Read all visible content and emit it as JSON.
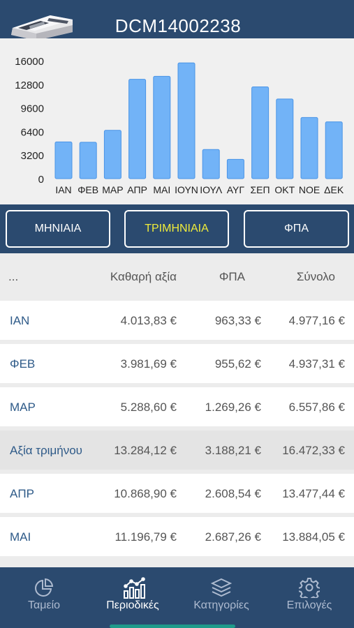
{
  "header": {
    "title": "DCM14002238",
    "device_icon": "cash-register-icon"
  },
  "chart_data": {
    "type": "bar",
    "categories": [
      "ΙΑΝ",
      "ΦΕΒ",
      "ΜΑΡ",
      "ΑΠΡ",
      "ΜΑΙ",
      "ΙΟΥΝ",
      "ΙΟΥΛ",
      "ΑΥΓ",
      "ΣΕΠ",
      "ΟΚΤ",
      "ΝΟΕ",
      "ΔΕΚ"
    ],
    "values": [
      4977,
      4937,
      6558,
      13477,
      13884,
      15700,
      3950,
      2620,
      12450,
      10800,
      8300,
      7700
    ],
    "yticks": [
      "0",
      "3200",
      "6400",
      "9600",
      "12800",
      "16000"
    ],
    "ylim": [
      0,
      16000
    ],
    "bar_color": "#72b3f7",
    "bar_border": "#4a94e6"
  },
  "segments": [
    {
      "label": "ΜΗΝΙΑΙΑ",
      "active": false
    },
    {
      "label": "ΤΡΙΜΗΝΙΑΙΑ",
      "active": true
    },
    {
      "label": "ΦΠΑ",
      "active": false
    }
  ],
  "table": {
    "headers": [
      "...",
      "Καθαρή αξία",
      "ΦΠΑ",
      "Σύνολο"
    ],
    "rows": [
      {
        "label": "ΙΑΝ",
        "net": "4.013,83 €",
        "vat": "963,33 €",
        "total": "4.977,16 €",
        "summary": false
      },
      {
        "label": "ΦΕΒ",
        "net": "3.981,69 €",
        "vat": "955,62 €",
        "total": "4.937,31 €",
        "summary": false
      },
      {
        "label": "ΜΑΡ",
        "net": "5.288,60 €",
        "vat": "1.269,26 €",
        "total": "6.557,86 €",
        "summary": false
      },
      {
        "label": "Αξία τριμήνου",
        "net": "13.284,12 €",
        "vat": "3.188,21 €",
        "total": "16.472,33 €",
        "summary": true
      },
      {
        "label": "ΑΠΡ",
        "net": "10.868,90 €",
        "vat": "2.608,54 €",
        "total": "13.477,44 €",
        "summary": false
      },
      {
        "label": "ΜΑΙ",
        "net": "11.196,79 €",
        "vat": "2.687,26 €",
        "total": "13.884,05 €",
        "summary": false
      }
    ]
  },
  "tabs": [
    {
      "label": "Ταμείο",
      "icon": "pie-chart-icon",
      "active": false
    },
    {
      "label": "Περιοδικές",
      "icon": "bar-chart-icon",
      "active": true
    },
    {
      "label": "Κατηγορίες",
      "icon": "layers-icon",
      "active": false
    },
    {
      "label": "Επιλογές",
      "icon": "gear-icon",
      "active": false
    }
  ]
}
